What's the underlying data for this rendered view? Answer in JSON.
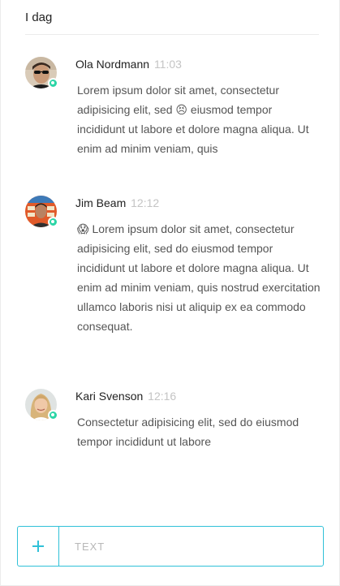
{
  "day_header": "I dag",
  "messages": [
    {
      "author": "Ola Nordmann",
      "time": "11:03",
      "text_before": "Lorem ipsum dolor sit amet, consectetur adipisicing elit, sed ",
      "emoji": "😣",
      "text_after": " eiusmod tempor incididunt ut labore et dolore magna aliqua. Ut enim ad minim veniam, quis",
      "status": "online"
    },
    {
      "author": "Jim Beam",
      "time": "12:12",
      "emoji": "😱",
      "text": " Lorem ipsum dolor sit amet, consectetur adipisicing elit, sed do eiusmod tempor incididunt ut labore et dolore magna aliqua. Ut enim ad minim veniam, quis nostrud exercitation ullamco laboris nisi ut aliquip ex ea commodo consequat.",
      "status": "online"
    },
    {
      "author": "Kari Svenson",
      "time": "12:16",
      "text": "Consectetur adipisicing elit, sed do eiusmod tempor incididunt ut labore",
      "status": "online"
    }
  ],
  "composer": {
    "add_icon": "plus-icon",
    "placeholder": "TEXT"
  },
  "colors": {
    "accent": "#30c1d8",
    "online": "#2bd5a6",
    "time": "#c4c4c4",
    "body_text": "#555555"
  }
}
